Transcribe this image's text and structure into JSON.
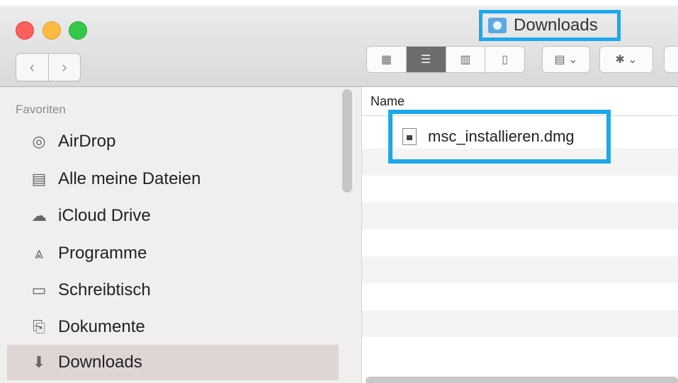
{
  "window": {
    "title": "Downloads"
  },
  "toolbar": {
    "back": "‹",
    "forward": "›",
    "view_icons": "▦",
    "view_list": "☰",
    "view_columns": "▥",
    "view_coverflow": "▯",
    "arrange": "▤ ⌄",
    "action": "✱ ⌄"
  },
  "sidebar": {
    "heading": "Favoriten",
    "items": [
      {
        "label": "AirDrop",
        "icon": "airdrop-icon",
        "glyph": "◎"
      },
      {
        "label": "Alle meine Dateien",
        "icon": "all-files-icon",
        "glyph": "▤"
      },
      {
        "label": "iCloud Drive",
        "icon": "cloud-icon",
        "glyph": "☁"
      },
      {
        "label": "Programme",
        "icon": "applications-icon",
        "glyph": "⩓"
      },
      {
        "label": "Schreibtisch",
        "icon": "desktop-icon",
        "glyph": "▭"
      },
      {
        "label": "Dokumente",
        "icon": "documents-icon",
        "glyph": "⎘"
      },
      {
        "label": "Downloads",
        "icon": "downloads-icon",
        "glyph": "⬇"
      }
    ],
    "selected": "Downloads"
  },
  "content": {
    "column_header": "Name",
    "files": [
      {
        "name": "msc_installieren.dmg",
        "icon": "disk-image-icon"
      }
    ]
  },
  "colors": {
    "highlight": "#1ba8ec",
    "sidebar_bg": "#f1eeee",
    "selected_bg": "#e0d5d5"
  }
}
